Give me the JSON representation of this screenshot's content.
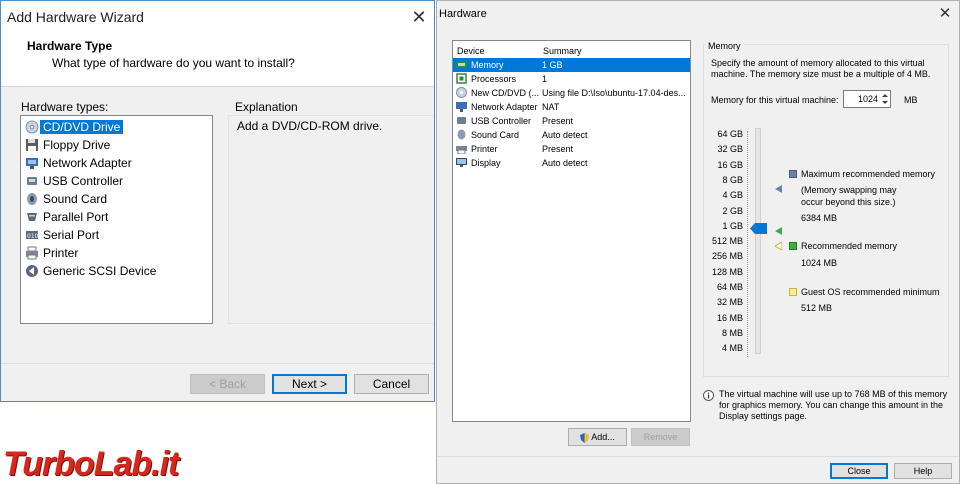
{
  "wizard": {
    "title": "Add Hardware Wizard",
    "close": "✕",
    "header_title": "Hardware Type",
    "header_subtitle": "What type of hardware do you want to install?",
    "types_label": "Hardware types:",
    "explanation_label": "Explanation",
    "explanation_text": "Add a DVD/CD-ROM drive.",
    "types": [
      {
        "label": "CD/DVD Drive",
        "icon": "cd-dvd-icon",
        "selected": true
      },
      {
        "label": "Floppy Drive",
        "icon": "floppy-icon",
        "selected": false
      },
      {
        "label": "Network Adapter",
        "icon": "network-icon",
        "selected": false
      },
      {
        "label": "USB Controller",
        "icon": "usb-icon",
        "selected": false
      },
      {
        "label": "Sound Card",
        "icon": "speaker-icon",
        "selected": false
      },
      {
        "label": "Parallel Port",
        "icon": "parallel-port-icon",
        "selected": false
      },
      {
        "label": "Serial Port",
        "icon": "serial-port-icon",
        "selected": false
      },
      {
        "label": "Printer",
        "icon": "printer-icon",
        "selected": false
      },
      {
        "label": "Generic SCSI Device",
        "icon": "scsi-icon",
        "selected": false
      }
    ],
    "buttons": {
      "back": "< Back",
      "next": "Next >",
      "cancel": "Cancel"
    }
  },
  "hardware": {
    "title": "Hardware",
    "close": "✕",
    "columns": {
      "device": "Device",
      "summary": "Summary"
    },
    "devices": [
      {
        "name": "Memory",
        "summary": "1 GB",
        "icon": "memory-icon",
        "selected": true
      },
      {
        "name": "Processors",
        "summary": "1",
        "icon": "processor-icon",
        "selected": false
      },
      {
        "name": "New CD/DVD (...",
        "summary": "Using file D:\\Iso\\ubuntu-17.04-des...",
        "icon": "cd-dvd-icon",
        "selected": false
      },
      {
        "name": "Network Adapter",
        "summary": "NAT",
        "icon": "network-icon",
        "selected": false
      },
      {
        "name": "USB Controller",
        "summary": "Present",
        "icon": "usb-icon",
        "selected": false
      },
      {
        "name": "Sound Card",
        "summary": "Auto detect",
        "icon": "speaker-icon",
        "selected": false
      },
      {
        "name": "Printer",
        "summary": "Present",
        "icon": "printer-icon",
        "selected": false
      },
      {
        "name": "Display",
        "summary": "Auto detect",
        "icon": "display-icon",
        "selected": false
      }
    ],
    "buttons": {
      "add": "Add...",
      "remove": "Remove",
      "close": "Close",
      "help": "Help"
    },
    "memory": {
      "group_label": "Memory",
      "description_line1": "Specify the amount of memory allocated to this virtual",
      "description_line2": "machine. The memory size must be a multiple of 4 MB.",
      "field_label": "Memory for this virtual machine:",
      "value": "1024",
      "unit": "MB",
      "scale": [
        "64 GB",
        "32 GB",
        "16 GB",
        "8 GB",
        "4 GB",
        "2 GB",
        "1 GB",
        "512 MB",
        "256 MB",
        "128 MB",
        "64 MB",
        "32 MB",
        "16 MB",
        "8 MB",
        "4 MB"
      ],
      "max_label": "Maximum recommended memory",
      "max_note_line1": "(Memory swapping may",
      "max_note_line2": "occur beyond this size.)",
      "max_value": "6384 MB",
      "rec_label": "Recommended memory",
      "rec_value": "1024 MB",
      "min_label": "Guest OS recommended minimum",
      "min_value": "512 MB",
      "info_line1": "The virtual machine will use up to 768 MB of this memory",
      "info_line2": "for graphics memory. You can change this amount in the",
      "info_line3": "Display settings page."
    }
  },
  "watermark": "TurboLab.it",
  "colors": {
    "accent": "#0078d7",
    "max_marker": "#6b7fa8",
    "rec_marker": "#3cb043",
    "min_marker": "#e8e08a"
  }
}
